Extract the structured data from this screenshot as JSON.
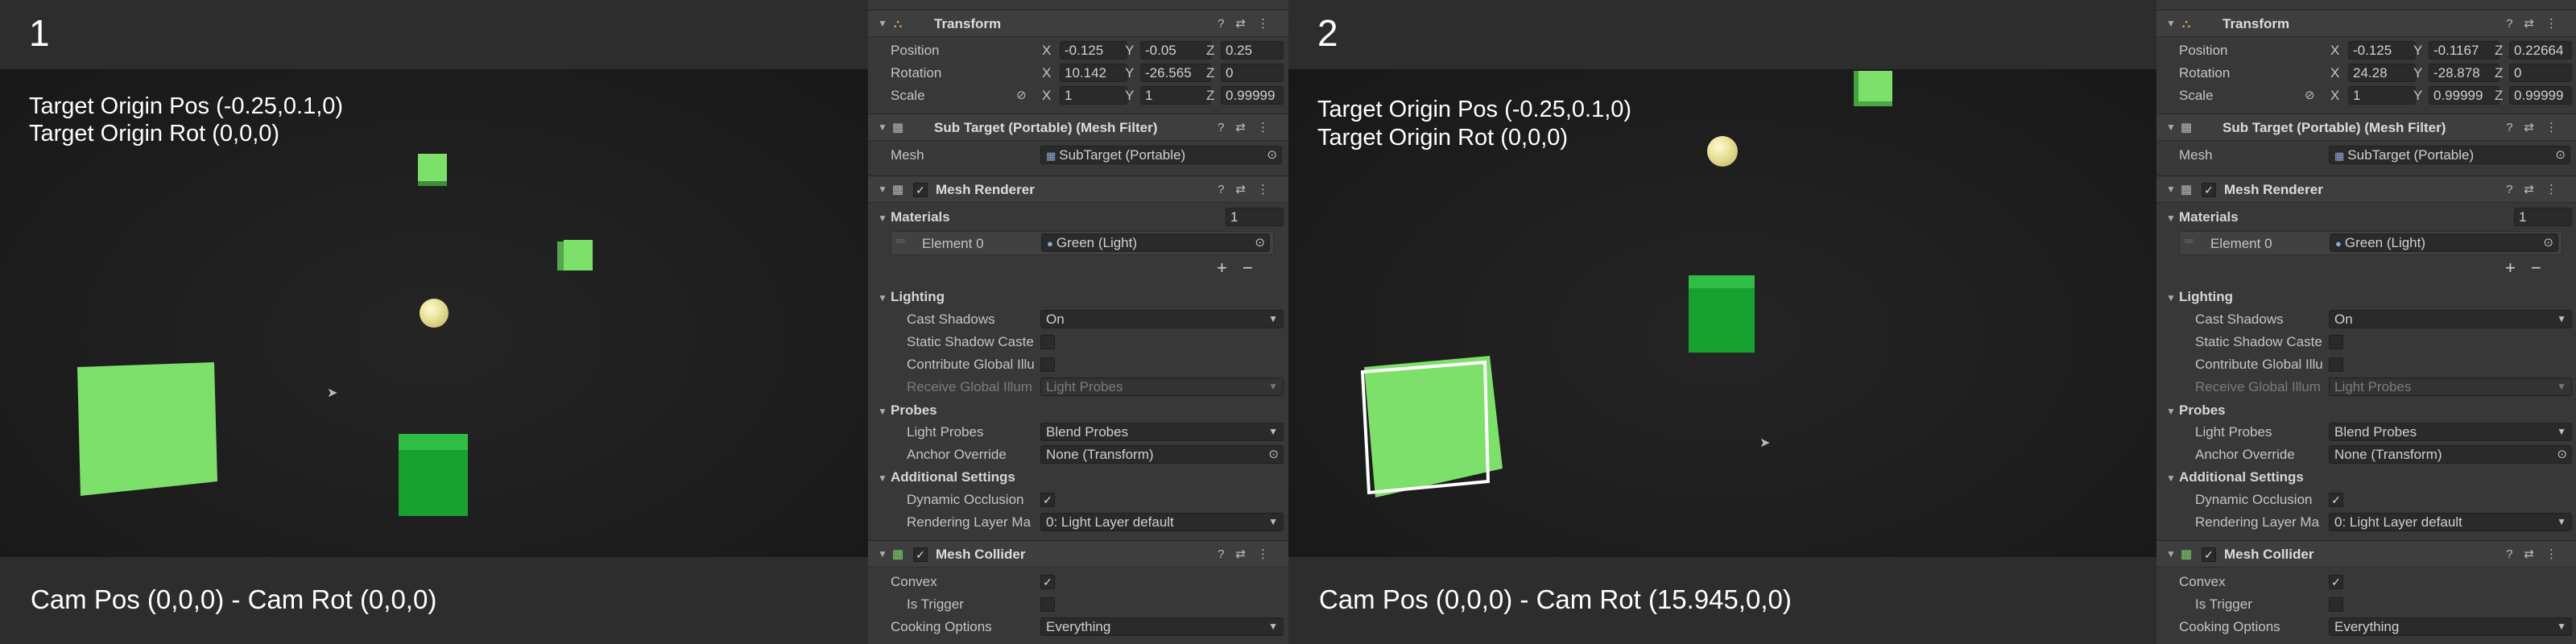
{
  "panels": [
    {
      "number": "1",
      "overlay_pos": "Target Origin Pos (-0.25,0.1,0)",
      "overlay_rot": "Target Origin Rot (0,0,0)",
      "cam_text": "Cam Pos (0,0,0) - Cam Rot (0,0,0)",
      "inspector": {
        "transform": {
          "title": "Transform",
          "position_label": "Position",
          "rotation_label": "Rotation",
          "scale_label": "Scale",
          "x_axis": "X",
          "y_axis": "Y",
          "z_axis": "Z",
          "position": {
            "x": "-0.125",
            "y": "-0.05",
            "z": "0.25"
          },
          "rotation": {
            "x": "10.142",
            "y": "-26.565",
            "z": "0"
          },
          "scale": {
            "x": "1",
            "y": "1",
            "z": "0.99999"
          }
        },
        "mesh_filter": {
          "title": "Sub Target (Portable) (Mesh Filter)",
          "mesh_label": "Mesh",
          "mesh_value": "SubTarget (Portable)"
        },
        "mesh_renderer": {
          "title": "Mesh Renderer",
          "checked": "✓",
          "materials_label": "Materials",
          "materials_count": "1",
          "element_label": "Element 0",
          "element_value": "Green (Light)",
          "add": "+",
          "remove": "−",
          "lighting_label": "Lighting",
          "cast_shadows_label": "Cast Shadows",
          "cast_shadows_value": "On",
          "static_shadow_label": "Static Shadow Caste",
          "contribute_gi_label": "Contribute Global Illu",
          "receive_gi_label": "Receive Global Illum",
          "receive_gi_value": "Light Probes",
          "probes_label": "Probes",
          "light_probes_label": "Light Probes",
          "light_probes_value": "Blend Probes",
          "anchor_label": "Anchor Override",
          "anchor_value": "None (Transform)",
          "additional_label": "Additional Settings",
          "dynamic_occlusion_label": "Dynamic Occlusion",
          "dynamic_occlusion_check": "✓",
          "rendering_layer_label": "Rendering Layer Ma",
          "rendering_layer_value": "0: Light Layer default"
        },
        "mesh_collider": {
          "title": "Mesh Collider",
          "checked": "✓",
          "convex_label": "Convex",
          "convex_check": "✓",
          "trigger_label": "Is Trigger",
          "cooking_label": "Cooking Options",
          "cooking_value": "Everything"
        }
      }
    },
    {
      "number": "2",
      "overlay_pos": "Target Origin Pos (-0.25,0.1,0)",
      "overlay_rot": "Target Origin Rot (0,0,0)",
      "cam_text": "Cam Pos (0,0,0) - Cam Rot (15.945,0,0)",
      "inspector": {
        "transform": {
          "title": "Transform",
          "position_label": "Position",
          "rotation_label": "Rotation",
          "scale_label": "Scale",
          "x_axis": "X",
          "y_axis": "Y",
          "z_axis": "Z",
          "position": {
            "x": "-0.125",
            "y": "-0.1167",
            "z": "0.22664"
          },
          "rotation": {
            "x": "24.28",
            "y": "-28.878",
            "z": "0"
          },
          "scale": {
            "x": "1",
            "y": "0.99999",
            "z": "0.99999"
          }
        },
        "mesh_filter": {
          "title": "Sub Target (Portable) (Mesh Filter)",
          "mesh_label": "Mesh",
          "mesh_value": "SubTarget (Portable)"
        },
        "mesh_renderer": {
          "title": "Mesh Renderer",
          "checked": "✓",
          "materials_label": "Materials",
          "materials_count": "1",
          "element_label": "Element 0",
          "element_value": "Green (Light)",
          "add": "+",
          "remove": "−",
          "lighting_label": "Lighting",
          "cast_shadows_label": "Cast Shadows",
          "cast_shadows_value": "On",
          "static_shadow_label": "Static Shadow Caste",
          "contribute_gi_label": "Contribute Global Illu",
          "receive_gi_label": "Receive Global Illum",
          "receive_gi_value": "Light Probes",
          "probes_label": "Probes",
          "light_probes_label": "Light Probes",
          "light_probes_value": "Blend Probes",
          "anchor_label": "Anchor Override",
          "anchor_value": "None (Transform)",
          "additional_label": "Additional Settings",
          "dynamic_occlusion_label": "Dynamic Occlusion",
          "dynamic_occlusion_check": "✓",
          "rendering_layer_label": "Rendering Layer Ma",
          "rendering_layer_value": "0: Light Layer default"
        },
        "mesh_collider": {
          "title": "Mesh Collider",
          "checked": "✓",
          "convex_label": "Convex",
          "convex_check": "✓",
          "trigger_label": "Is Trigger",
          "cooking_label": "Cooking Options",
          "cooking_value": "Everything"
        }
      }
    }
  ],
  "icons": {
    "transform": "transform-gizmo-icon",
    "mesh_filter": "grid-icon",
    "mesh_renderer": "grid-icon",
    "mesh_collider": "collider-grid-icon",
    "help": "help-icon",
    "preset": "preset-icon",
    "menu": "kebab-menu-icon",
    "object_picker": "target-circle-icon",
    "dropdown": "triangle-down-icon",
    "link": "constrain-link-icon"
  },
  "colors": {
    "cube_light": "#7de06a",
    "cube_dark": "#18a12e",
    "sphere": "#e9e39a",
    "inspector_bg": "#383838",
    "scene_bg": "#1d1d1d"
  }
}
